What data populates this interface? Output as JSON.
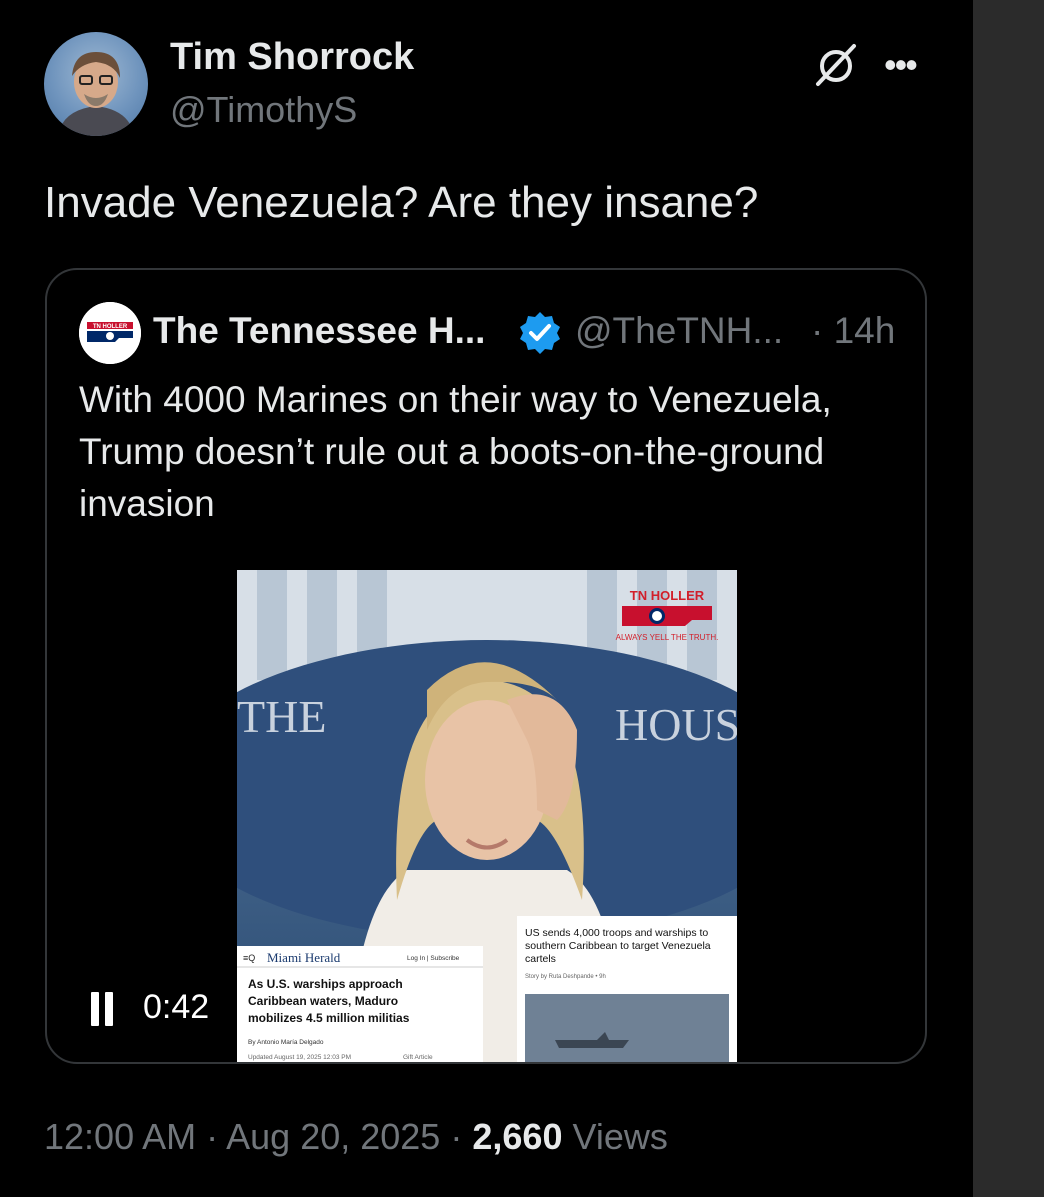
{
  "author": {
    "display_name": "Tim Shorrock",
    "handle": "@TimothyS"
  },
  "icons": {
    "grok": "grok-icon",
    "more": "more-icon",
    "verified": "verified-badge-icon",
    "pause": "pause-icon"
  },
  "tweet": {
    "text": "Invade Venezuela? Are they insane?"
  },
  "quote": {
    "display_name": "The Tennessee H...",
    "handle": "@TheTNH...",
    "time": "· 14h",
    "text": "With 4000 Marines on their way to Venezuela, Trump doesn’t rule out a boots-on-the-ground invasion",
    "avatar_logo_text": "TN HOLLER",
    "video": {
      "duration": "0:42",
      "watermark_title": "TN HOLLER",
      "watermark_tagline": "ALWAYS YELL THE TRUTH.",
      "backdrop_text_left": "THE",
      "backdrop_text_right": "HOUS",
      "article_left": {
        "masthead": "Miami Herald",
        "nav": "Log In | Subscribe",
        "headline": "As U.S. warships approach Caribbean waters, Maduro mobilizes 4.5 million militias",
        "byline": "By Antonio María Delgado",
        "updated": "Updated August 19, 2025 12:03 PM",
        "gift": "Gift Article"
      },
      "article_right": {
        "headline": "US sends 4,000 troops and warships to southern Caribbean to target Venezuela cartels",
        "byline": "Story by Ruta Deshpande • 9h"
      }
    }
  },
  "meta": {
    "time": "12:00 AM",
    "date": "Aug 20, 2025",
    "views_count": "2,660",
    "views_label": "Views",
    "separator": "·"
  },
  "colors": {
    "background": "#000000",
    "text_primary": "#e7e9ea",
    "text_secondary": "#71767b",
    "border": "#333639",
    "verified_blue": "#1d9bf0"
  }
}
